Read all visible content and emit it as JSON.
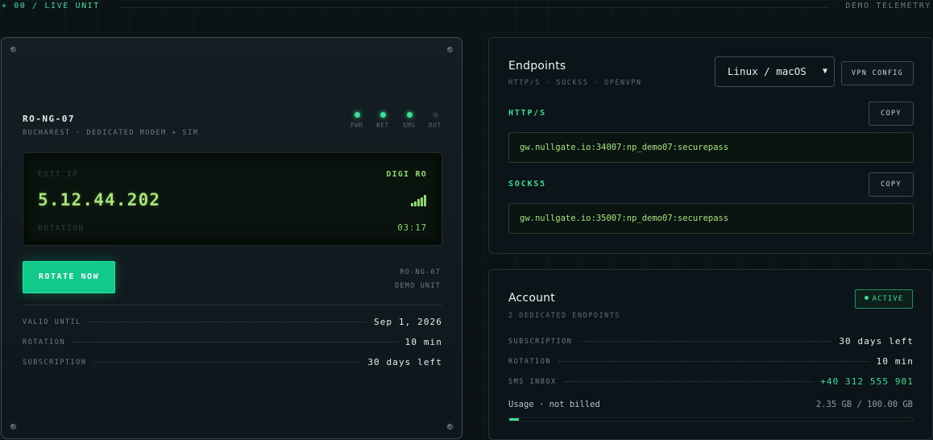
{
  "topbar": {
    "left": "+ 00 / LIVE UNIT",
    "right": "DEMO TELEMETRY"
  },
  "device": {
    "id": "RO-NG-07",
    "location": "BUCHAREST · DEDICATED MODEM + SIM",
    "leds": [
      {
        "label": "PWR",
        "on": true
      },
      {
        "label": "NET",
        "on": true
      },
      {
        "label": "SMS",
        "on": true
      },
      {
        "label": "ROT",
        "on": false
      }
    ],
    "screen": {
      "exit_label": "EXIT IP",
      "carrier": "DIGI RO",
      "ip": "5.12.44.202",
      "rotation_label": "ROTATION",
      "timer": "03:17",
      "signal_bars": 5
    },
    "rotate_button": "ROTATE NOW",
    "unit_id": "RO-NG-07",
    "unit_note": "DEMO UNIT",
    "details": [
      {
        "key": "VALID UNTIL",
        "value": "Sep 1, 2026"
      },
      {
        "key": "ROTATION",
        "value": "10 min"
      },
      {
        "key": "SUBSCRIPTION",
        "value": "30 days left"
      }
    ]
  },
  "endpoints": {
    "title": "Endpoints",
    "subtitle": "HTTP/S · SOCKS5 · OPENVPN",
    "os_select": "Linux / macOS",
    "vpn_button": "VPN CONFIG",
    "items": [
      {
        "label": "HTTP/S",
        "copy": "COPY",
        "value": "gw.nullgate.io:34007:np_demo07:securepass"
      },
      {
        "label": "SOCKS5",
        "copy": "COPY",
        "value": "gw.nullgate.io:35007:np_demo07:securepass"
      }
    ]
  },
  "account": {
    "title": "Account",
    "subtitle": "2 DEDICATED ENDPOINTS",
    "status": "ACTIVE",
    "rows": [
      {
        "key": "SUBSCRIPTION",
        "value": "30 days left"
      },
      {
        "key": "ROTATION",
        "value": "10 min"
      },
      {
        "key": "SMS INBOX",
        "value": "+40 312 555 901"
      }
    ],
    "usage_label": "Usage · not billed",
    "usage_value": "2.35 GB / 100.00 GB",
    "usage_fraction": 0.0235
  },
  "colors": {
    "accent": "#3ddc97",
    "screen_text": "#a6e37a",
    "button": "#10c98a"
  }
}
